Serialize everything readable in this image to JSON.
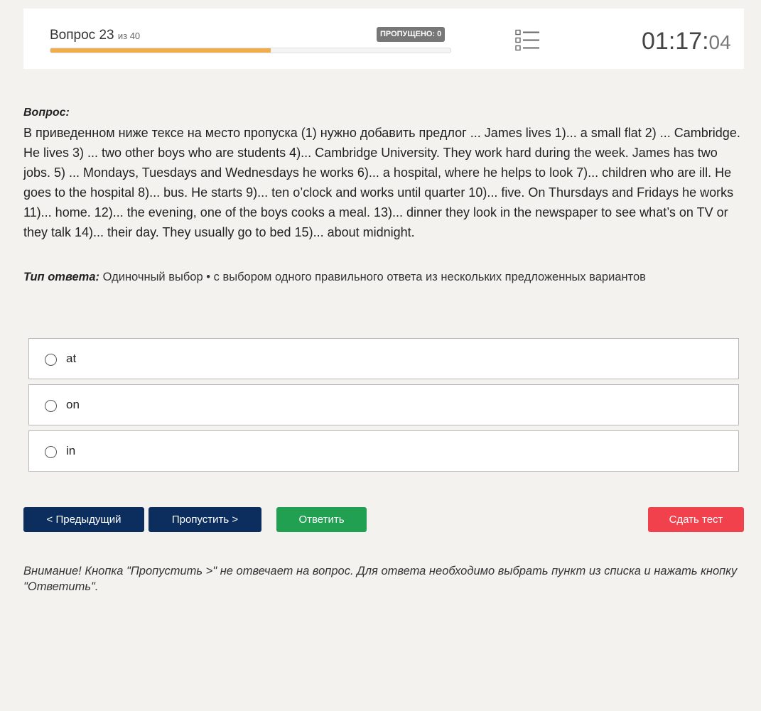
{
  "header": {
    "question_label": "Вопрос 23",
    "question_of": "из 40",
    "progress_fraction": 0.55,
    "progress_color": "#f0ad4e",
    "skipped_badge": "ПРОПУЩЕНО: 0",
    "list_icon": "list-icon",
    "timer_main": "01:17:",
    "timer_seconds": "04"
  },
  "question": {
    "label": "Вопрос:",
    "text": "В приведенном ниже тексе на место пропуска (1) нужно добавить предлог ... James lives 1)... a small flat 2) ... Cambridge. He lives 3) ... two other boys who are students 4)... Cambridge University. They work hard during the week. James has two jobs. 5) ... Mondays, Tuesdays and Wednesdays he works 6)... a hospital, where he helps to look 7)... children who are ill. He goes to the hospital 8)... bus. He starts 9)... ten o’clock and works until quarter 10)... five. On Thursdays and Fridays he works 11)... home. 12)... the evening, one of the boys cooks a meal. 13)... dinner they look in the newspaper to see what’s on TV or they talk 14)... their day. They usually go to bed 15)... about midnight."
  },
  "answer_type": {
    "label": "Тип ответа:",
    "value": "Одиночный выбор • с выбором одного правильного ответа из нескольких предложенных вариантов"
  },
  "options": [
    {
      "label": "at"
    },
    {
      "label": "on"
    },
    {
      "label": "in"
    }
  ],
  "buttons": {
    "prev": "< Предыдущий",
    "skip": "Пропустить >",
    "answer": "Ответить",
    "submit": "Сдать тест"
  },
  "colors": {
    "nav_button": "#0b2e5e",
    "answer_button": "#22a052",
    "submit_button": "#f0414d"
  },
  "warning": "Внимание! Кнопка \"Пропустить >\" не отвечает на вопрос. Для ответа необходимо выбрать пункт из списка и нажать кнопку \"Ответить\"."
}
